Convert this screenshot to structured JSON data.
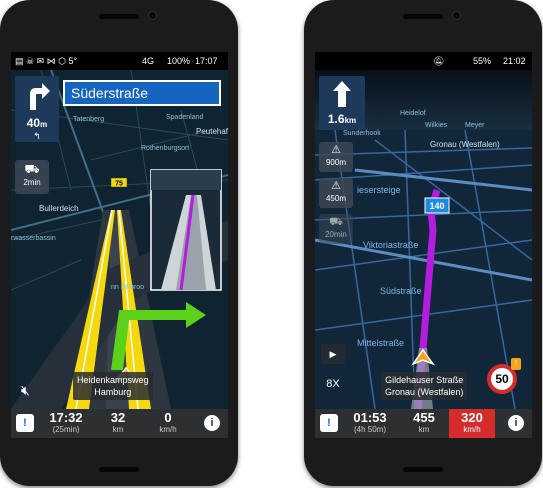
{
  "left": {
    "status": {
      "time": "17:07",
      "left_icons": "▤ ☠ ✉ ⋈ ⬡ 5°",
      "network": "4G",
      "battery": "100%"
    },
    "maneuver": {
      "distance": "40",
      "unit": "m",
      "street": "Süderstraße"
    },
    "eta_button": "2min",
    "road_badge": "75",
    "labels": {
      "tatenberg": "Tatenberg",
      "spadenland": "Spadenland",
      "peutehafen": "Peutehafen",
      "rothenburgsort": "Rothenburgsort",
      "bullerdeich": "Bullerdeich",
      "wassabassin": "rwasserbassin",
      "billbrook": "nn Billbroo"
    },
    "destination": {
      "line1": "Heidenkampsweg",
      "line2": "Hamburg"
    },
    "stats": [
      {
        "value": "17:32",
        "unit": "(25min)"
      },
      {
        "value": "32",
        "unit": "km"
      },
      {
        "value": "0",
        "unit": "km/h"
      }
    ]
  },
  "right": {
    "status": {
      "time": "21:02",
      "battery": "55%"
    },
    "maneuver": {
      "distance": "1.6",
      "unit": "km"
    },
    "warnings": [
      {
        "label": "900m"
      },
      {
        "label": "450m"
      },
      {
        "label": "20min"
      }
    ],
    "speed_badge": "140",
    "labels": {
      "heidelof": "Heidelof",
      "sunderhook": "Sunderhook",
      "wilkies": "Wilkies",
      "meyer": "Meyer",
      "gronau": "Gronau (Westfalen)",
      "eisersteige": "iesersteige",
      "viktoriastrasse": "Viktoriastraße",
      "suedstrasse": "Südstraße",
      "mittelstrasse": "Mittelstraße"
    },
    "play_label": "▶",
    "zoom_label": "8X",
    "destination": {
      "line1": "Gildehauser Straße",
      "line2": "Gronau (Westfalen)"
    },
    "speed_limit": "50",
    "stats": [
      {
        "value": "01:53",
        "unit": "(4h 50m)"
      },
      {
        "value": "455",
        "unit": "km"
      },
      {
        "value": "320",
        "unit": "km/h"
      }
    ]
  },
  "colors": {
    "route_yellow": "#f5d90c",
    "route_purple": "#b21de0",
    "lane_green": "#5bd119",
    "nav_blue": "#1565c0",
    "speed_red": "#d52b2b"
  }
}
